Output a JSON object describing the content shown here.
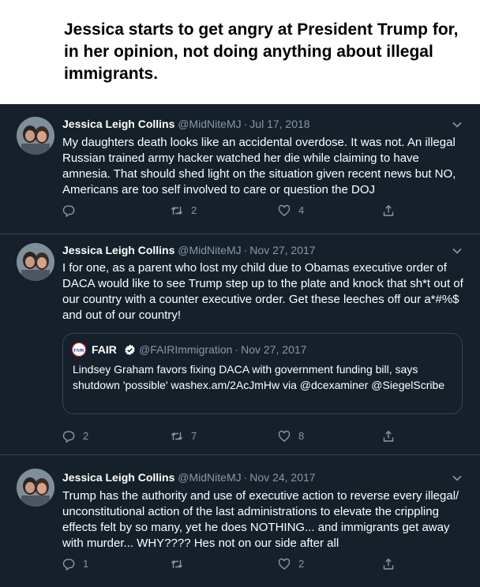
{
  "caption": "Jessica starts to get angry at President Trump for, in her opinion, not doing anything about illegal immigrants.",
  "colors": {
    "background": "#15202b",
    "text": "#ffffff",
    "muted": "#8899a6",
    "border": "#38444d",
    "verified": "#1da1f2"
  },
  "tweets": [
    {
      "name": "Jessica Leigh Collins",
      "handle": "@MidNiteMJ",
      "date": "Jul 17, 2018",
      "text": "My daughters death looks like an accidental overdose. It was not. An illegal Russian trained army hacker watched her die while claiming to have amnesia. That should shed light on the situation given recent news but NO, Americans are too self involved to care or question the DOJ",
      "replies": "",
      "retweets": "2",
      "likes": "4"
    },
    {
      "name": "Jessica Leigh Collins",
      "handle": "@MidNiteMJ",
      "date": "Nov 27, 2017",
      "text": "I for one, as a parent who lost my child due to Obamas executive order of DACA would like to see Trump step up to the plate and knock that sh*t out of our country with a counter executive order. Get these leeches off our a*#%$ and out of our country!",
      "quote": {
        "logo_text": "FAIR",
        "name": "FAIR",
        "handle": "@FAIRImmigration",
        "date": "Nov 27, 2017",
        "text": "Lindsey Graham favors fixing DACA with government funding bill, says shutdown 'possible' washex.am/2AcJmHw via @dcexaminer @SiegelScribe"
      },
      "replies": "2",
      "retweets": "7",
      "likes": "8"
    },
    {
      "name": "Jessica Leigh Collins",
      "handle": "@MidNiteMJ",
      "date": "Nov 24, 2017",
      "text": "Trump has the authority and use of executive action to reverse every illegal/ unconstitutional action of the last administrations to elevate the crippling effects felt by so many, yet he does NOTHING... and immigrants get away with murder... WHY???? Hes not on our side after all",
      "replies": "1",
      "retweets": "",
      "likes": "2"
    }
  ],
  "icons": {
    "reply": "reply-icon",
    "retweet": "retweet-icon",
    "like": "heart-icon",
    "share": "share-icon",
    "more": "chevron-down-icon",
    "verified": "verified-badge-icon"
  }
}
